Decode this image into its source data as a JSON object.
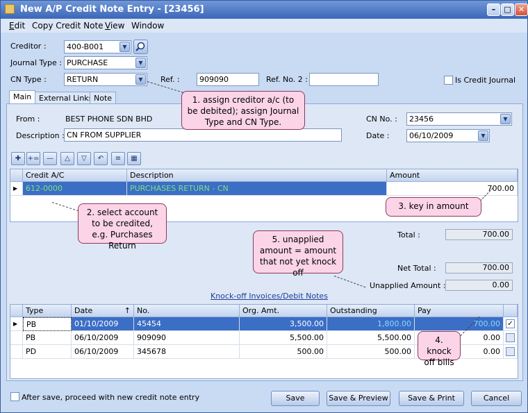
{
  "window": {
    "title": "New A/P Credit Note Entry - [23456]"
  },
  "menu": {
    "items": [
      {
        "label": "Edit",
        "u": "E",
        "rest": "dit"
      },
      {
        "label": "Copy Credit Note",
        "u": "",
        "rest": "Copy Credit Note"
      },
      {
        "label": "View",
        "u": "V",
        "rest": "iew"
      },
      {
        "label": "Window",
        "u": "",
        "rest": "Window"
      }
    ]
  },
  "header": {
    "creditor_label": "Creditor :",
    "creditor_value": "400-B001",
    "journal_label": "Journal Type :",
    "journal_value": "PURCHASE",
    "cntype_label": "CN Type :",
    "cntype_value": "RETURN",
    "ref_label": "Ref. :",
    "ref_value": "909090",
    "ref2_label": "Ref. No. 2 :",
    "ref2_value": "",
    "credit_journal_label": "Is Credit Journal"
  },
  "tabs": [
    {
      "label": "Main"
    },
    {
      "label": "External Links"
    },
    {
      "label": "Note"
    }
  ],
  "main": {
    "from_label": "From :",
    "from_value": "BEST PHONE SDN BHD",
    "desc_label": "Description :",
    "desc_value": "CN FROM SUPPLIER",
    "cnno_label": "CN No. :",
    "cnno_value": "23456",
    "date_label": "Date :",
    "date_value": "06/10/2009"
  },
  "detail_grid": {
    "headers": [
      "Credit A/C",
      "Description",
      "Amount"
    ],
    "rows": [
      {
        "account": "612-0000",
        "description": "PURCHASES RETURN - CN",
        "amount": "700.00"
      }
    ]
  },
  "totals": {
    "total_label": "Total :",
    "total_value": "700.00",
    "net_label": "Net Total :",
    "net_value": "700.00",
    "unapplied_label": "Unapplied Amount :",
    "unapplied_value": "0.00"
  },
  "knockoff": {
    "title": "Knock-off Invoices/Debit Notes",
    "headers": [
      "Type",
      "Date",
      "No.",
      "Org. Amt.",
      "Outstanding",
      "Pay"
    ],
    "rows": [
      {
        "type": "PB",
        "date": "01/10/2009",
        "no": "45454",
        "org": "3,500.00",
        "out": "1,800.00",
        "pay": "700.00",
        "checked": true
      },
      {
        "type": "PB",
        "date": "06/10/2009",
        "no": "909090",
        "org": "5,500.00",
        "out": "5,500.00",
        "pay": "0.00",
        "checked": false
      },
      {
        "type": "PD",
        "date": "06/10/2009",
        "no": "345678",
        "org": "500.00",
        "out": "500.00",
        "pay": "0.00",
        "checked": false
      }
    ]
  },
  "notes": {
    "n1": "1. assign creditor a/c (to be debited); assign Journal Type and CN Type.",
    "n2": "2. select account to be credited, e.g. Purchases Return",
    "n3": "3. key in amount",
    "n4": "4. knock off bills",
    "n5": "5. unapplied amount = amount that not yet knock off"
  },
  "footer": {
    "proceed_label": "After save, proceed with new credit note entry",
    "save": "Save",
    "save_preview": "Save & Preview",
    "save_print": "Save & Print",
    "cancel": "Cancel"
  }
}
